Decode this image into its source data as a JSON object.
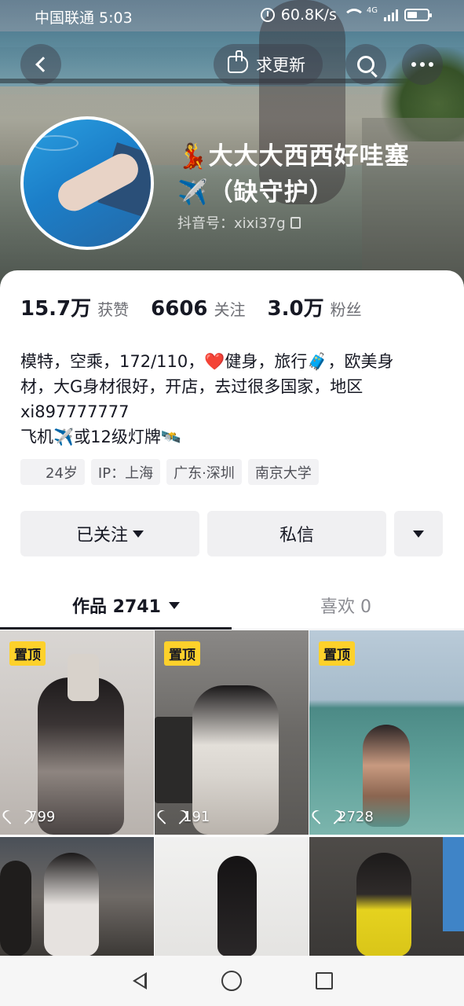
{
  "status_bar": {
    "carrier_time": "中国联通 5:03",
    "network_speed": "60.8K/s",
    "network_type": "4G",
    "icons": [
      "alarm-icon",
      "wifi-icon",
      "signal-icon",
      "battery-icon"
    ]
  },
  "top_bar": {
    "back_icon": "chevron-left-icon",
    "request_update_label": "求更新",
    "request_update_icon": "hand-point-icon",
    "search_icon": "search-icon",
    "more_icon": "more-dots-icon"
  },
  "profile": {
    "name_line1": "💃大大大西西好哇塞",
    "name_line2": "✈️（缺守护）",
    "account_id": "抖音号：xixi37g",
    "copy_icon": "copy-icon"
  },
  "stats": {
    "likes_value": "15.7万",
    "likes_label": "获赞",
    "following_value": "6606",
    "following_label": "关注",
    "followers_value": "3.0万",
    "followers_label": "粉丝"
  },
  "bio": {
    "line1": "模特，空乘，172/110，❤️健身，旅行🧳，欧美身",
    "line2": "材，大G身材很好，开店，去过很多国家，地区",
    "line3": "xi897777777",
    "line4": "飞机✈️或12级灯牌🛰️"
  },
  "tags": {
    "age": "24岁",
    "ip": "IP：上海",
    "location": "广东·深圳",
    "school": "南京大学"
  },
  "actions": {
    "follow_label": "已关注",
    "message_label": "私信",
    "more_icon": "triangle-down-icon"
  },
  "tabs": {
    "works_label": "作品 2741",
    "likes_label": "喜欢 0"
  },
  "grid": {
    "pin_label": "置顶",
    "tiles": [
      {
        "pinned": true,
        "likes": "799"
      },
      {
        "pinned": true,
        "likes": "191"
      },
      {
        "pinned": true,
        "likes": "2728"
      },
      {
        "pinned": false,
        "likes": ""
      },
      {
        "pinned": false,
        "likes": ""
      },
      {
        "pinned": false,
        "likes": ""
      }
    ]
  },
  "nav_bar": {
    "icons": [
      "nav-back-icon",
      "nav-home-icon",
      "nav-recent-icon"
    ]
  },
  "colors": {
    "pin_badge": "#fdd12b",
    "text_primary": "#161823",
    "text_secondary": "#6e6f75",
    "button_bg": "#f0f0f2"
  }
}
